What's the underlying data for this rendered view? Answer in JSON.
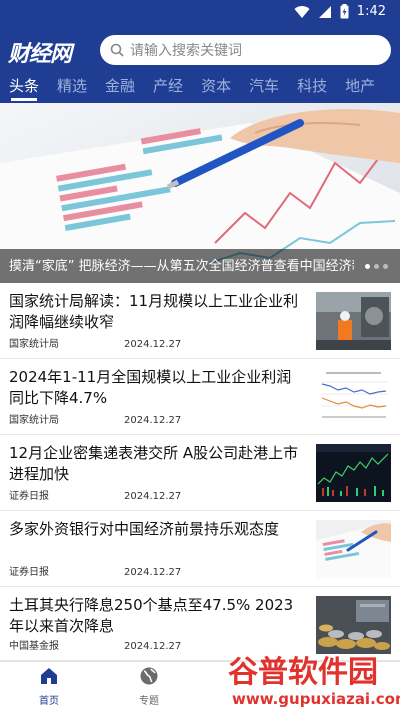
{
  "status_bar": {
    "time": "1:42"
  },
  "header": {
    "logo_text": "财经网"
  },
  "search": {
    "placeholder": "请输入搜索关键词"
  },
  "tabs": [
    {
      "label": "头条",
      "active": true
    },
    {
      "label": "精选"
    },
    {
      "label": "金融"
    },
    {
      "label": "产经"
    },
    {
      "label": "资本"
    },
    {
      "label": "汽车"
    },
    {
      "label": "科技"
    },
    {
      "label": "地产"
    }
  ],
  "banner": {
    "caption": "摸清“家底” 把脉经济——从第五次全国经济普查看中国经济新..."
  },
  "news": [
    {
      "title": "国家统计局解读：11月规模以上工业企业利润降幅继续收窄",
      "source": "国家统计局",
      "date": "2024.12.27"
    },
    {
      "title": "2024年1-11月全国规模以上工业企业利润同比下降4.7%",
      "source": "国家统计局",
      "date": "2024.12.27"
    },
    {
      "title": "12月企业密集递表港交所 A股公司赴港上市进程加快",
      "source": "证券日报",
      "date": "2024.12.27"
    },
    {
      "title": "多家外资银行对中国经济前景持乐观态度",
      "source": "证券日报",
      "date": "2024.12.27"
    },
    {
      "title": "土耳其央行降息250个基点至47.5% 2023年以来首次降息",
      "source": "中国基金报",
      "date": "2024.12.27"
    }
  ],
  "bottom_nav": [
    {
      "label": "首页",
      "active": true
    },
    {
      "label": "专题"
    }
  ],
  "watermark": {
    "title": "谷普软件园",
    "url": "www.gupuxiazai.com"
  },
  "colors": {
    "brand": "#1f3e93",
    "watermark": "#e2322e"
  }
}
